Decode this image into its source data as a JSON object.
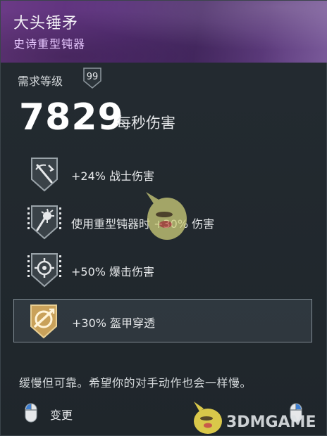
{
  "header": {
    "title": "大头锤矛",
    "subtitle": "史诗重型钝器"
  },
  "requirement": {
    "label": "需求等级",
    "level": "99"
  },
  "dps": {
    "value": "7829",
    "label": "每秒伤害"
  },
  "perks": [
    {
      "icon": "sword-slash-icon",
      "label": "+24% 战士伤害"
    },
    {
      "icon": "mace-icon",
      "label": "使用重型钝器时 +30% 伤害"
    },
    {
      "icon": "crosshair-icon",
      "label": "+50% 爆击伤害"
    },
    {
      "icon": "armor-pierce-icon",
      "label": "+30% 盔甲穿透"
    }
  ],
  "description": "缓慢但可靠。希望你的对手动作也会一样慢。",
  "footer": {
    "action_label": "变更",
    "watermark": "3DMGAME"
  },
  "colors": {
    "header_accent": "#5c3380",
    "subtitle": "#e7c8ff",
    "gold": "#c9a15a"
  }
}
